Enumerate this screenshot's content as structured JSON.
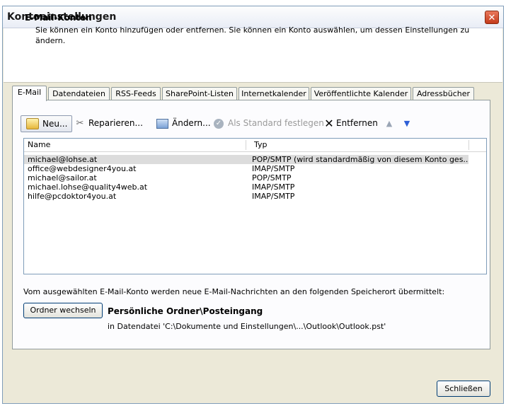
{
  "window": {
    "title": "Kontoeinstellungen",
    "close_glyph": "✕"
  },
  "header": {
    "title": "E-Mail-Konten",
    "description": "Sie können ein Konto hinzufügen oder entfernen. Sie können ein Konto auswählen, um dessen Einstellungen zu ändern."
  },
  "tabs": [
    {
      "label": "E-Mail",
      "active": true
    },
    {
      "label": "Datendateien"
    },
    {
      "label": "RSS-Feeds"
    },
    {
      "label": "SharePoint-Listen"
    },
    {
      "label": "Internetkalender"
    },
    {
      "label": "Veröffentlichte Kalender"
    },
    {
      "label": "Adressbücher"
    }
  ],
  "toolbar": {
    "new_label": "Neu...",
    "repair_label": "Reparieren...",
    "change_label": "Ändern...",
    "default_label": "Als Standard festlegen",
    "remove_label": "Entfernen",
    "icons": {
      "new": "mail-new-icon",
      "repair": "tools-icon",
      "change": "change-icon",
      "default": "checkmark-icon",
      "remove": "x-icon",
      "up": "arrow-up-icon",
      "down": "arrow-down-icon"
    }
  },
  "accounts": {
    "columns": {
      "name": "Name",
      "type": "Typ"
    },
    "rows": [
      {
        "name": "michael@lohse.at",
        "type": "POP/SMTP (wird standardmäßig von diesem Konto ges...",
        "selected": true
      },
      {
        "name": "office@webdesigner4you.at",
        "type": "IMAP/SMTP"
      },
      {
        "name": "michael@sailor.at",
        "type": "POP/SMTP"
      },
      {
        "name": "michael.lohse@quality4web.at",
        "type": "IMAP/SMTP"
      },
      {
        "name": "hilfe@pcdoktor4you.at",
        "type": "IMAP/SMTP"
      }
    ]
  },
  "delivery": {
    "info": "Vom ausgewählten E-Mail-Konto werden neue E-Mail-Nachrichten an den folgenden Speicherort übermittelt:",
    "change_folder_label": "Ordner wechseln",
    "folder": "Persönliche Ordner\\Posteingang",
    "datafile": "in Datendatei 'C:\\Dokumente und Einstellungen\\...\\Outlook\\Outlook.pst'"
  },
  "footer": {
    "close_label": "Schließen"
  },
  "colors": {
    "selection": "#dcdcdc",
    "dialog_bg": "#ece9d8",
    "close_red": "#d14a2a",
    "arrow_blue": "#2e5fd6"
  }
}
